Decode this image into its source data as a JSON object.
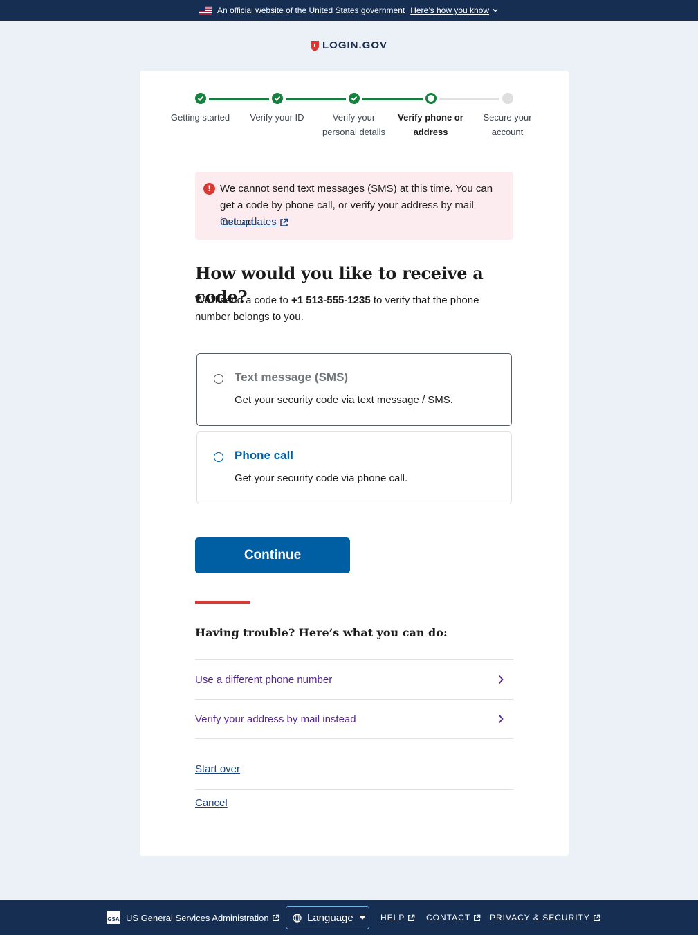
{
  "banner": {
    "text": "An official website of the United States government",
    "link": "Here’s how you know"
  },
  "logo": {
    "text": "LOGIN.GOV"
  },
  "steps": [
    {
      "label": "Getting started",
      "status": "complete"
    },
    {
      "label": "Verify your ID",
      "status": "complete"
    },
    {
      "label": "Verify your personal details",
      "status": "complete"
    },
    {
      "label": "Verify phone or address",
      "status": "current"
    },
    {
      "label": "Secure your account",
      "status": "incomplete"
    }
  ],
  "alert": {
    "message": "We cannot send text messages (SMS) at this time. You can get a code by phone call, or verify your address by mail instead.",
    "link": "Get updates"
  },
  "page": {
    "title": "How would you like to receive a code?",
    "intro_before": "We’ll send a code to ",
    "phone": "+1 513-555-1235",
    "intro_after": " to verify that the phone number belongs to you."
  },
  "options": [
    {
      "title": "Text message (SMS)",
      "description": "Get your security code via text message / SMS.",
      "disabled": true
    },
    {
      "title": "Phone call",
      "description": "Get your security code via phone call.",
      "disabled": false
    }
  ],
  "continue_label": "Continue",
  "trouble": {
    "heading": "Having trouble? Here’s what you can do:",
    "items": [
      "Use a different phone number",
      "Verify your address by mail instead"
    ]
  },
  "start_over": "Start over",
  "cancel": "Cancel",
  "footer": {
    "gsa_logo": "GSA",
    "gsa_text": "US General Services Administration",
    "language": "Language",
    "help": "HELP",
    "contact": "CONTACT",
    "privacy": "PRIVACY & SECURITY"
  },
  "colors": {
    "primary": "#005ea2",
    "success": "#15803d",
    "error": "#d83933",
    "banner_bg": "#162e51",
    "visited_link": "#54278f"
  }
}
